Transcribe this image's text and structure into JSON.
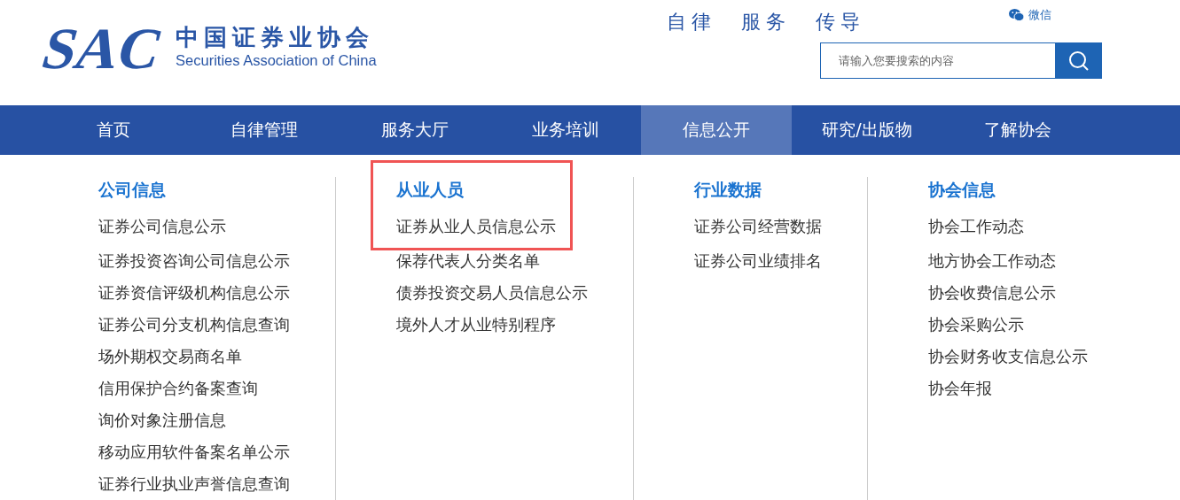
{
  "logo": {
    "mark": "SAC",
    "name_cn": "中国证券业协会",
    "name_en": "Securities Association of China"
  },
  "motto": [
    "自律",
    "服务",
    "传导"
  ],
  "wechat": {
    "label": "微信"
  },
  "search": {
    "placeholder": "请输入您要搜索的内容"
  },
  "nav": [
    {
      "label": "首页",
      "selected": false
    },
    {
      "label": "自律管理",
      "selected": false
    },
    {
      "label": "服务大厅",
      "selected": false
    },
    {
      "label": "业务培训",
      "selected": false
    },
    {
      "label": "信息公开",
      "selected": true
    },
    {
      "label": "研究/出版物",
      "selected": false
    },
    {
      "label": "了解协会",
      "selected": false
    }
  ],
  "menu": [
    {
      "heading": "公司信息",
      "highlighted": false,
      "items": [
        "证券公司信息公示",
        "证券投资咨询公司信息公示",
        "证券资信评级机构信息公示",
        "证券公司分支机构信息查询",
        "场外期权交易商名单",
        "信用保护合约备案查询",
        "询价对象注册信息",
        "移动应用软件备案名单公示",
        "证券行业执业声誉信息查询"
      ]
    },
    {
      "heading": "从业人员",
      "highlighted": true,
      "items": [
        "证券从业人员信息公示",
        "保荐代表人分类名单",
        "债券投资交易人员信息公示",
        "境外人才从业特别程序"
      ]
    },
    {
      "heading": "行业数据",
      "highlighted": false,
      "items": [
        "证券公司经营数据",
        "证券公司业绩排名"
      ]
    },
    {
      "heading": "协会信息",
      "highlighted": false,
      "items": [
        "协会工作动态",
        "地方协会工作动态",
        "协会收费信息公示",
        "协会采购公示",
        "协会财务收支信息公示",
        "协会年报"
      ]
    }
  ]
}
